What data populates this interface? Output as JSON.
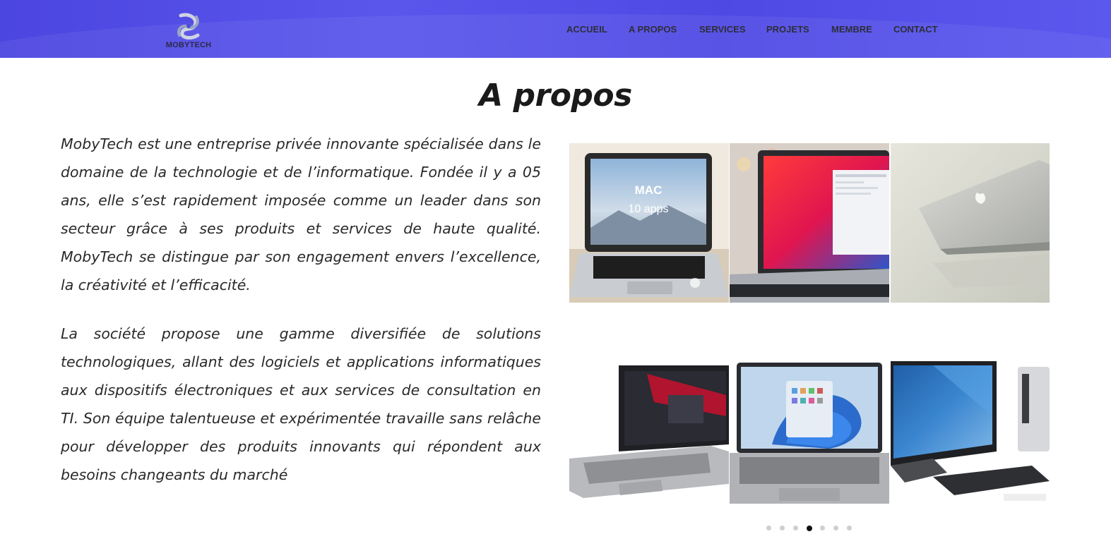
{
  "brand": {
    "name": "MOBYTECH"
  },
  "nav": {
    "items": [
      {
        "label": "ACCUEIL"
      },
      {
        "label": "A PROPOS"
      },
      {
        "label": "SERVICES"
      },
      {
        "label": "PROJETS"
      },
      {
        "label": "MEMBRE"
      },
      {
        "label": "CONTACT"
      }
    ]
  },
  "main": {
    "title": "A propos",
    "paragraphs": [
      "MobyTech est une entreprise privée innovante spécialisée dans le domaine de la technologie et de l’informatique. Fondée il y a 05 ans, elle s’est rapidement imposée comme un leader dans son secteur grâce à ses produits et services de haute qualité. MobyTech se distingue par son engagement envers l’excellence, la créativité et l’efficacité.",
      "La société propose une gamme diversifiée de solutions technologiques, allant des logiciels et applications informatiques aux dispositifs électroniques et aux services de consultation en TI. Son équipe talentueuse et expérimentée travaille sans relâche pour développer des produits innovants qui répondent aux besoins changeants du marché"
    ]
  },
  "gallery": {
    "row1": [
      {
        "icon": "macbook-photo",
        "screen_text_1": "MAC",
        "screen_text_2": "10 apps"
      },
      {
        "icon": "macbook-pro-red-wallpaper-photo"
      },
      {
        "icon": "macbook-air-lid-photo"
      }
    ],
    "row2": [
      {
        "icon": "lenovo-thinkpad-photo"
      },
      {
        "icon": "windows-11-laptop-photo"
      },
      {
        "icon": "all-in-one-desktop-photo"
      }
    ]
  },
  "carousel": {
    "total": 7,
    "active": 4
  },
  "colors": {
    "header_bg": "#5451e8",
    "nav_text": "#2d2d3a",
    "active_dot": "#111111"
  }
}
